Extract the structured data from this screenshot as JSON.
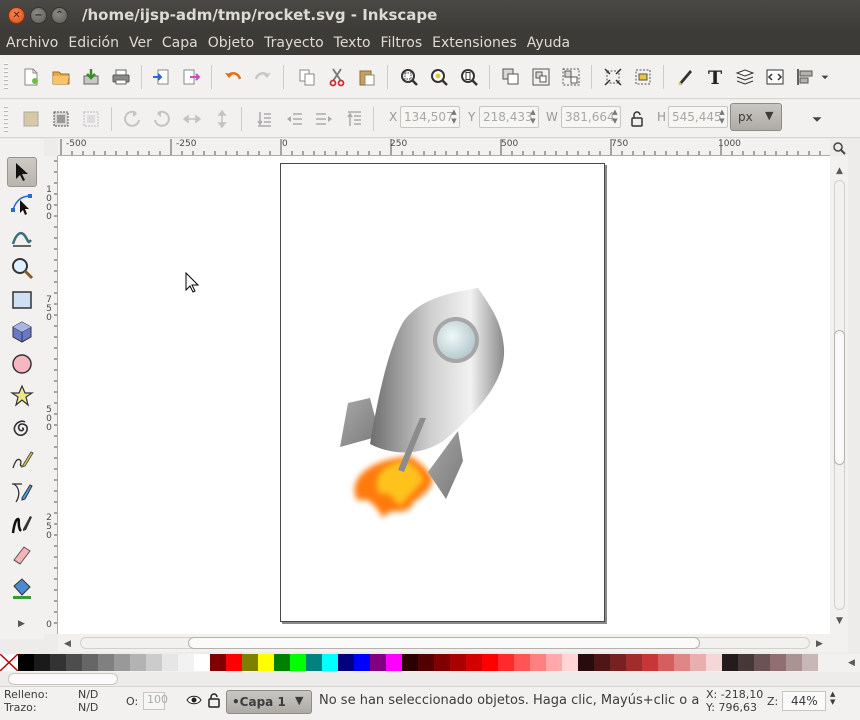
{
  "window": {
    "title": "/home/ijsp-adm/tmp/rocket.svg - Inkscape",
    "close_glyph": "✕",
    "min_glyph": "−",
    "max_glyph": "⌃"
  },
  "menu": [
    "Archivo",
    "Edición",
    "Ver",
    "Capa",
    "Objeto",
    "Trayecto",
    "Texto",
    "Filtros",
    "Extensiones",
    "Ayuda"
  ],
  "controls": {
    "x_label": "X",
    "x_value": "134,507",
    "y_label": "Y",
    "y_value": "218,433",
    "w_label": "W",
    "w_value": "381,664",
    "h_label": "H",
    "h_value": "545,445",
    "unit": "px"
  },
  "rulers": {
    "h_labels": [
      "-500",
      "-250",
      "0",
      "250",
      "500",
      "750",
      "1000"
    ],
    "v_labels": [
      "1000",
      "750",
      "500",
      "250",
      "0"
    ]
  },
  "tools": [
    "selector-tool",
    "node-tool",
    "tweak-tool",
    "zoom-tool",
    "rect-tool",
    "3dbox-tool",
    "circle-tool",
    "star-tool",
    "spiral-tool",
    "pencil-tool",
    "pen-tool",
    "calligraphy-tool",
    "eraser-tool",
    "paint-bucket-tool"
  ],
  "palette": [
    "#000000",
    "#1a1a1a",
    "#333333",
    "#4d4d4d",
    "#666666",
    "#808080",
    "#999999",
    "#b3b3b3",
    "#cccccc",
    "#e6e6e6",
    "#f2f2f2",
    "#ffffff",
    "#800000",
    "#ff0000",
    "#808000",
    "#ffff00",
    "#008000",
    "#00ff00",
    "#008080",
    "#00ffff",
    "#000080",
    "#0000ff",
    "#800080",
    "#ff00ff",
    "#2b0000",
    "#550000",
    "#800000",
    "#aa0000",
    "#d40000",
    "#ff0000",
    "#ff2a2a",
    "#ff5555",
    "#ff8080",
    "#ffaaaa",
    "#ffd5d5",
    "#280b0b",
    "#501616",
    "#782121",
    "#a02c2c",
    "#c83737",
    "#d35f5f",
    "#de8787",
    "#e9afaf",
    "#f4d7d7",
    "#241c1c",
    "#483737",
    "#6c5353",
    "#916f6f",
    "#ac9393",
    "#c8b7b7"
  ],
  "status": {
    "fill_label": "Relleno:",
    "fill_value": "N/D",
    "stroke_label": "Trazo:",
    "stroke_value": "N/D",
    "opacity_label": "O:",
    "opacity_value": "100",
    "layer": "•Capa 1",
    "message": "No se han seleccionado objetos. Haga clic, Mayús+clic o a",
    "cursor_x": "X: -218,10",
    "cursor_y": "Y:  796,63",
    "zoom_label": "Z:",
    "zoom_value": "44%"
  }
}
